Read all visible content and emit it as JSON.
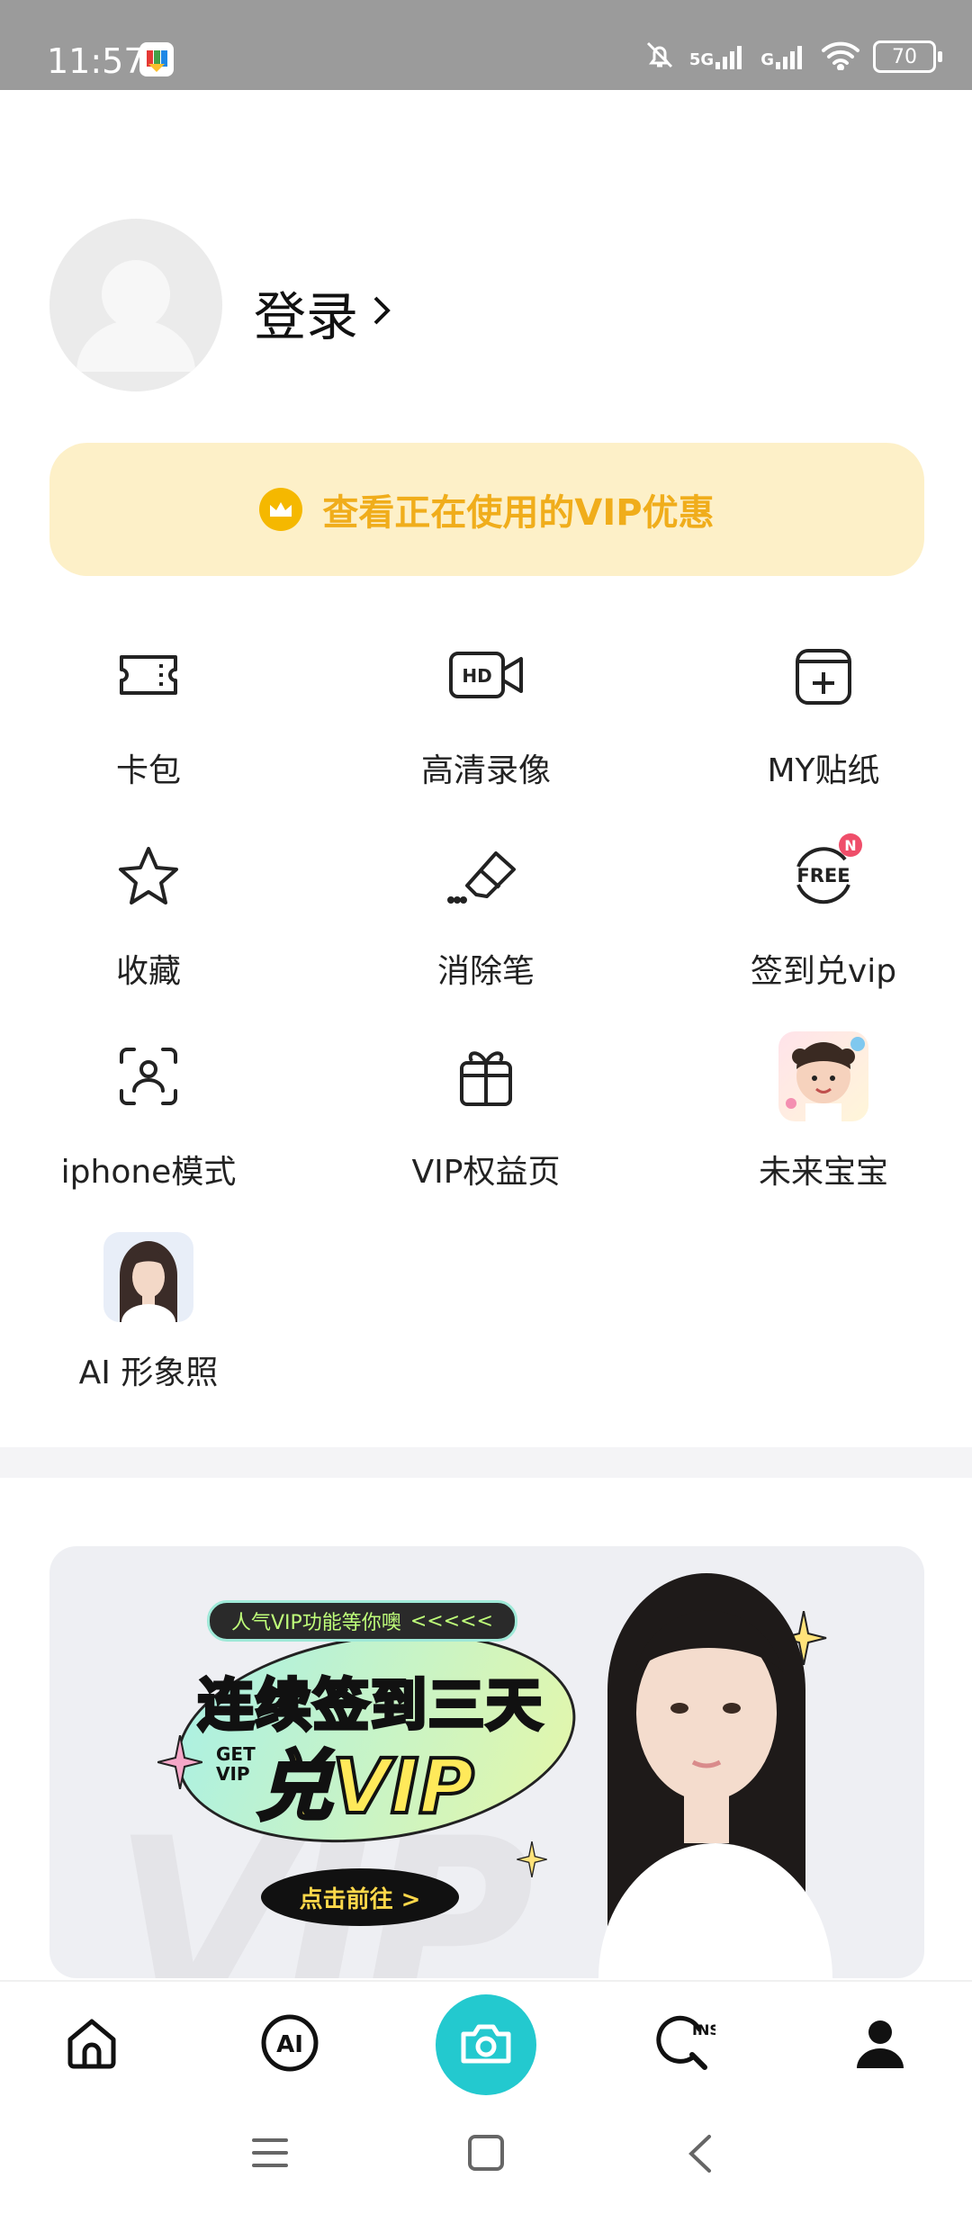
{
  "status_bar": {
    "time": "11:57",
    "network_label": "5G",
    "network_label2": "G",
    "battery": "70"
  },
  "profile": {
    "login_label": "登录",
    "login_chevron": "›"
  },
  "vip_banner": {
    "text": "查看正在使用的VIP优惠",
    "accent": "#f0ad1b",
    "bg": "#fdf0c8"
  },
  "menu": [
    {
      "label": "卡包",
      "icon": "ticket-icon"
    },
    {
      "label": "高清录像",
      "icon": "hd-video-icon"
    },
    {
      "label": "MY贴纸",
      "icon": "sticker-add-icon"
    },
    {
      "label": "收藏",
      "icon": "star-icon"
    },
    {
      "label": "消除笔",
      "icon": "eraser-icon"
    },
    {
      "label": "签到兑vip",
      "icon": "free-icon",
      "badge": "N",
      "icon_text": "FREE"
    },
    {
      "label": "iphone模式",
      "icon": "face-scan-icon"
    },
    {
      "label": "VIP权益页",
      "icon": "gift-icon"
    },
    {
      "label": "未来宝宝",
      "icon": "baby-photo-icon"
    },
    {
      "label": "AI 形象照",
      "icon": "portrait-photo-icon"
    }
  ],
  "promo": {
    "tag": "人气VIP功能等你噢",
    "tag_arrows": "<<<<<",
    "headline": "连续签到三天",
    "get_vip": "GET VIP",
    "big": "兑VIP",
    "button": "点击前往 >",
    "watermark": "VIP"
  },
  "bottom_nav": [
    {
      "name": "home",
      "icon": "home-icon"
    },
    {
      "name": "ai",
      "icon": "ai-icon",
      "text": "AI"
    },
    {
      "name": "camera",
      "icon": "camera-icon",
      "color": "#23c9cf"
    },
    {
      "name": "ins",
      "icon": "ins-search-icon",
      "text": "INS"
    },
    {
      "name": "profile",
      "icon": "person-icon"
    }
  ]
}
